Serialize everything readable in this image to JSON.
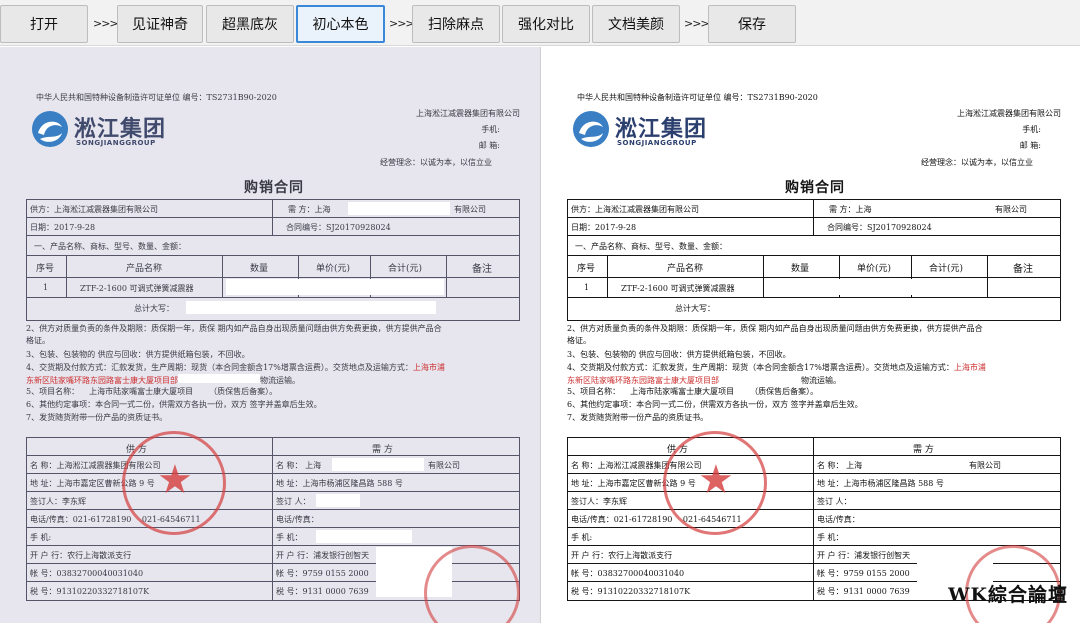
{
  "toolbar": {
    "open": "打开",
    "sep1": ">>>",
    "witness": "见证神奇",
    "super_black": "超黑底灰",
    "original_color": "初心本色",
    "sep2": ">>>",
    "remove_spots": "扫除麻点",
    "enhance_contrast": "强化对比",
    "beautify": "文档美颜",
    "sep3": ">>>",
    "save": "保存"
  },
  "doc": {
    "license": "中华人民共和国特种设备制造许可证单位 编号：TS2731B90-2020",
    "logo_cn": "淞江集团",
    "logo_en": "SONGJIANGGROUP",
    "header_company": "上海淞江减震器集团有限公司",
    "header_phone": "手机:",
    "header_postcode": "邮 箱:",
    "header_motto": "经营理念：以诚为本，以信立业",
    "title": "购销合同",
    "supplier": "供方：上海淞江减震器集团有限公司",
    "buyer_label": "需 方：上海",
    "buyer_suffix": "有限公司",
    "date": "日期：2017-9-28",
    "contract_no": "合同编号：SJ20170928024",
    "section1": "一、产品名称、商标、型号、数量、金额：",
    "col_no": "序号",
    "col_name": "产品名称",
    "col_qty": "数量",
    "col_price": "单价(元)",
    "col_total": "合计(元)",
    "col_remark": "备注",
    "row_no": "1",
    "row_name": "ZTF-2-1600 可调式弹簧减震器",
    "total_words": "总计大写：",
    "clause2a": "2、供方对质量负责的条件及期限：质保期一年，质保 期内如产品自身出现质量问题由供方免费更换，供方提供产品合",
    "clause2b": "格证。",
    "clause3": "3、包装、包装物的 供应与回收：供方提供纸箱包装，不回收。",
    "clause4a": "4、交货期及付款方式：汇款发货，生产周期：现货（本合同金额含17%增票含运费）。交货地点及运输方式：",
    "clause4a_red": "上海市浦",
    "clause4b_red": "东新区陆家嘴环路东园路富士康大厦项目部",
    "clause4b_tail": "物流运输。",
    "clause5_label": "5、项目名称：",
    "clause5_value": "上海市陆家嘴富士康大厦项目",
    "clause5_tail": "（质保售后备案）。",
    "clause6": "6、其他约定事项：本合同一式二份，供需双方各执一份，双方 签字并盖章后生效。",
    "clause7": "7、发货随货附带一份产品的资质证书。",
    "sup_header": "供 方",
    "buy_header": "需 方",
    "sup_name": "名 称：上海淞江减震器集团有限公司",
    "buy_name_label": "名 称： 上海",
    "buy_name_suffix": "有限公司",
    "sup_address": "地 址：上海市嘉定区曹新公路 9 号",
    "buy_address": "地 址：上海市杨浦区隆昌路 588 号",
    "sup_signer": "签订人：李东辉",
    "buy_signer": "签订 人：",
    "sup_phone": "电话/传真：021-61728190　 021-64546711",
    "buy_phone": "电话/传真：",
    "sup_mobile": "手 机:",
    "buy_mobile": "手 机：",
    "sup_bank": "开 户 行：农行上海散派支行",
    "buy_bank": "开 户 行：浦发银行创智天",
    "sup_account": "帐 号：03832700040031040",
    "buy_account": "帐 号：9759 0155 2000",
    "sup_tax": "税 号：91310220332718107K",
    "buy_tax": "税 号：9131 0000 7639"
  },
  "watermark": "WK綜合論壇",
  "colors": {
    "active_border": "#3a88d8",
    "red_text": "#cc3030",
    "stamp": "#d43c3c",
    "logo": "#2b3f6e"
  }
}
